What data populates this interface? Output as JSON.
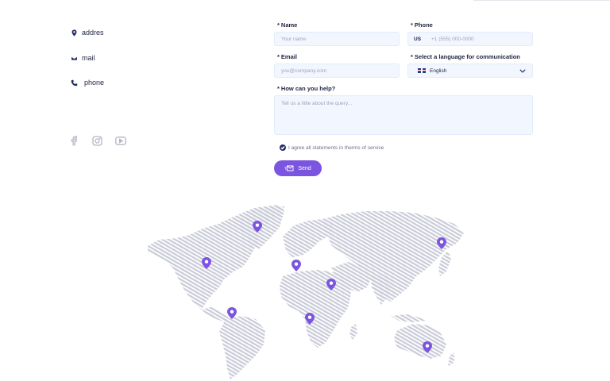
{
  "contact": {
    "address": "addres",
    "mail": "mail",
    "phone": "phone"
  },
  "social": [
    "facebook-icon",
    "instagram-icon",
    "youtube-icon"
  ],
  "form": {
    "name_label": "Name",
    "name_placeholder": "Your name",
    "phone_label": "Phone",
    "phone_country": "US",
    "phone_placeholder": "+1 (555) 000-0000",
    "email_label": "Email",
    "email_placeholder": "you@company.com",
    "language_label": "Select a language for communication",
    "language_value": "English",
    "help_label": "How can you help?",
    "help_placeholder": "Tell us a little about the query...",
    "required_mark": "*",
    "agree_text": "I agree all statements in therms of servise",
    "send_label": "Send"
  },
  "colors": {
    "accent": "#7b55e0",
    "navy": "#1e2a66",
    "field_bg": "#f2f6ff",
    "map_stripes": "#c9cbd8"
  }
}
